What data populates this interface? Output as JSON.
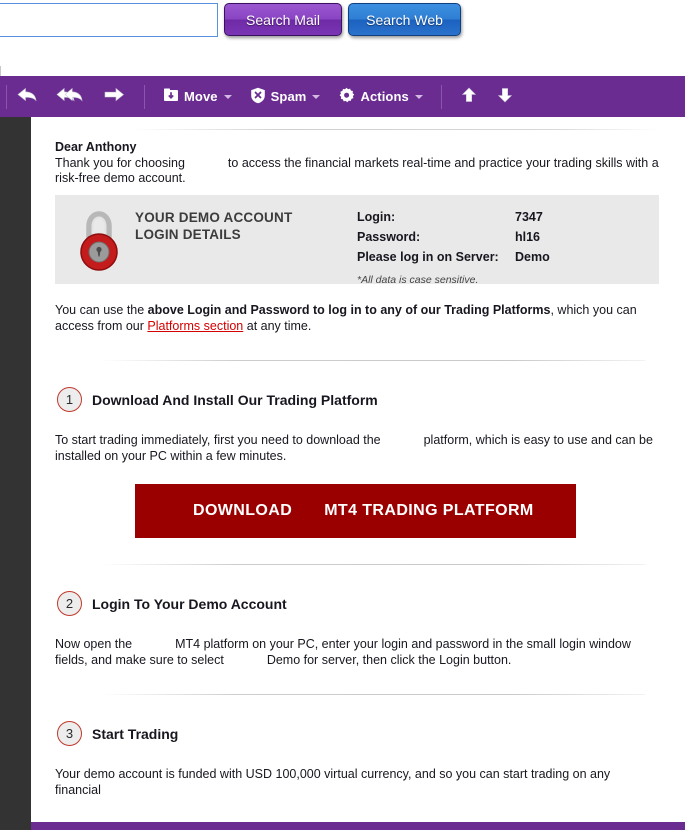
{
  "search": {
    "input_value": "",
    "placeholder": "",
    "search_mail_label": "Search Mail",
    "search_web_label": "Search Web"
  },
  "toolbar": {
    "reply_icon": "reply-arrow-icon",
    "reply_all_icon": "reply-all-arrow-icon",
    "forward_icon": "forward-arrow-icon",
    "move_label": "Move",
    "move_icon": "folder-move-icon",
    "spam_label": "Spam",
    "spam_icon": "shield-spam-icon",
    "actions_label": "Actions",
    "actions_icon": "gear-icon",
    "previous_icon": "up-arrow-icon",
    "next_icon": "down-arrow-icon",
    "accent_color": "#6a2c90"
  },
  "email": {
    "greeting": "Dear Anthony",
    "intro_before": "Thank you for choosing",
    "intro_after": "to access the financial markets real-time and practice your trading skills with a risk-free demo account.",
    "login_panel": {
      "title_line1": "YOUR DEMO ACCOUNT",
      "title_line2": "LOGIN DETAILS",
      "lock_icon": "padlock-icon",
      "lock_color": "#cc2222",
      "rows": [
        {
          "label": "Login:",
          "value": "7347"
        },
        {
          "label": "Password:",
          "value": "hl16"
        },
        {
          "label": "Please log in on Server:",
          "value": "Demo"
        }
      ],
      "note": "*All data is case sensitive.",
      "background": "#e9e9e9"
    },
    "platforms_para": {
      "part1": "You can use the ",
      "bold": "above Login and Password to log in to any of our Trading Platforms",
      "part2": ", which you can access from our ",
      "link": "Platforms section",
      "part3": " at any time.",
      "link_color": "#d50000"
    },
    "steps": [
      {
        "number": "1",
        "title": "Download And Install Our Trading Platform",
        "body_before": "To start trading immediately, first you need to download the",
        "body_after": "platform, which is easy to use and can be installed on your PC within a few minutes."
      },
      {
        "number": "2",
        "title": "Login To Your Demo Account",
        "body_before": "Now open the",
        "body_mid": "MT4 platform on your PC, enter your login and password in the small login window fields, and make sure to select",
        "body_after": "Demo for server, then click the Login button."
      },
      {
        "number": "3",
        "title": "Start Trading",
        "body_before": "Your demo account is funded with USD 100,000 virtual currency, and so you can start trading on any financial"
      }
    ],
    "download_button": {
      "label_left": "DOWNLOAD",
      "label_right": "MT4 TRADING PLATFORM",
      "background": "#9b0000"
    }
  }
}
